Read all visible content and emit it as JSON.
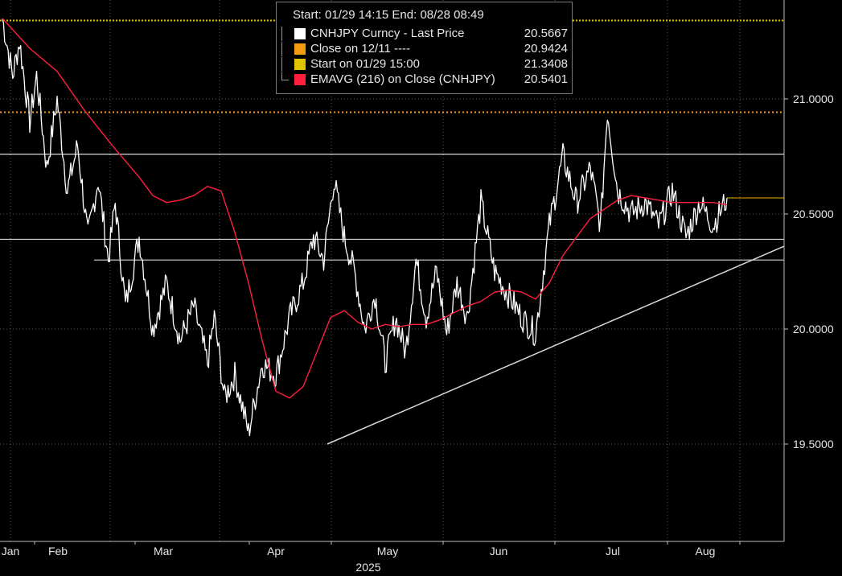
{
  "legend": {
    "header": "Start: 01/29 14:15 End: 08/28 08:49",
    "rows": [
      {
        "label": "CNHJPY Curncy - Last Price",
        "value": "20.5667",
        "color": "#ffffff"
      },
      {
        "label": "Close on 12/11 ----",
        "value": "20.9424",
        "color": "#f39c12"
      },
      {
        "label": "Start on 01/29 15:00",
        "value": "21.3408",
        "color": "#e0c400"
      },
      {
        "label": "EMAVG (216)  on Close (CNHJPY)",
        "value": "20.5401",
        "color": "#ff1e3c"
      }
    ]
  },
  "chart_data": {
    "type": "line",
    "ylim": [
      19.05,
      21.45
    ],
    "y_ticks": [
      "21.0000",
      "20.5000",
      "20.0000",
      "19.5000"
    ],
    "x_ticks": [
      "Jan",
      "Feb",
      "Mar",
      "Apr",
      "May",
      "Jun",
      "Jul",
      "Aug"
    ],
    "x_year": "2025",
    "reference_lines": {
      "start": 21.3408,
      "close_12_11": 20.9424
    },
    "horizontal_lines": [
      20.76,
      20.39,
      20.3
    ],
    "trendline": {
      "from": [
        "Apr 13",
        19.5
      ],
      "to": [
        "Aug 28",
        20.36
      ]
    },
    "series": [
      {
        "name": "CNHJPY Curncy - Last Price",
        "color": "#ffffff",
        "x": [
          0,
          3,
          5,
          8,
          10,
          13,
          16,
          19,
          22,
          25,
          28,
          31,
          33,
          36,
          40,
          44,
          48,
          52,
          56,
          60,
          62,
          65,
          68,
          72,
          76,
          80,
          84,
          88,
          91,
          94,
          97,
          100,
          103,
          106,
          109,
          112,
          115,
          118,
          121,
          124,
          127,
          130,
          133,
          136,
          140,
          144,
          148,
          152,
          156,
          160,
          164,
          168,
          172,
          175,
          177,
          180,
          184,
          188,
          192,
          196,
          200,
          204,
          208,
          212
        ],
        "y": [
          21.35,
          21.1,
          21.25,
          20.9,
          21.1,
          20.7,
          21.0,
          20.6,
          20.8,
          20.4,
          20.65,
          20.3,
          20.55,
          20.1,
          20.4,
          20.0,
          20.2,
          19.95,
          20.1,
          19.85,
          20.05,
          19.7,
          19.8,
          19.55,
          19.85,
          19.8,
          20.05,
          20.2,
          20.4,
          20.3,
          20.65,
          20.4,
          20.25,
          20.0,
          20.15,
          19.85,
          20.05,
          19.9,
          20.3,
          20.05,
          20.25,
          19.98,
          20.2,
          20.05,
          20.55,
          20.25,
          20.15,
          20.05,
          19.98,
          20.45,
          20.75,
          20.55,
          20.7,
          20.45,
          20.95,
          20.6,
          20.5,
          20.55,
          20.45,
          20.6,
          20.4,
          20.55,
          20.45,
          20.57
        ]
      },
      {
        "name": "EMAVG (216)  on Close (CNHJPY)",
        "color": "#ff1e3c",
        "x": [
          0,
          8,
          16,
          24,
          32,
          40,
          44,
          48,
          52,
          56,
          60,
          64,
          68,
          72,
          76,
          80,
          84,
          88,
          92,
          96,
          100,
          104,
          108,
          112,
          116,
          120,
          124,
          128,
          132,
          136,
          140,
          144,
          148,
          152,
          156,
          160,
          164,
          168,
          172,
          176,
          180,
          184,
          188,
          192,
          196,
          200,
          204,
          208,
          212
        ],
        "y": [
          21.35,
          21.22,
          21.12,
          20.95,
          20.8,
          20.66,
          20.58,
          20.55,
          20.56,
          20.58,
          20.62,
          20.6,
          20.42,
          20.2,
          19.95,
          19.73,
          19.7,
          19.75,
          19.9,
          20.05,
          20.08,
          20.03,
          20.0,
          20.02,
          20.01,
          20.02,
          20.02,
          20.04,
          20.07,
          20.1,
          20.12,
          20.16,
          20.17,
          20.16,
          20.13,
          20.2,
          20.32,
          20.4,
          20.48,
          20.52,
          20.56,
          20.58,
          20.57,
          20.56,
          20.55,
          20.55,
          20.55,
          20.55,
          20.54
        ]
      }
    ]
  }
}
